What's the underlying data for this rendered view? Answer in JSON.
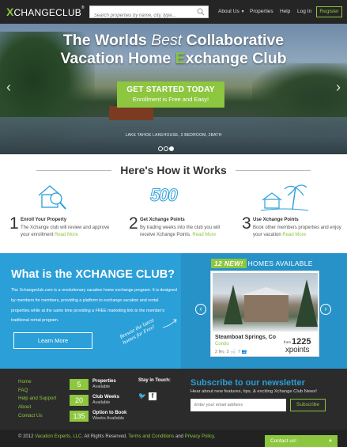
{
  "nav": {
    "logo_x": "X",
    "logo_rest": "CHANGECLUB",
    "search_placeholder": "Search properties by name, city, type...",
    "about": "About Us",
    "properties": "Properties",
    "help": "Help",
    "login": "Log In",
    "register": "Register"
  },
  "hero": {
    "title_part1": "The Worlds ",
    "title_best": "Best",
    "title_part2": " Collaborative",
    "title_line2a": "Vacation Home ",
    "title_line2_green": "E",
    "title_line2b": "xchange Club",
    "cta_line1": "GET STARTED TODAY",
    "cta_line2": "Enrollment is Free and Easy!",
    "caption": "LAKE TAHOE LAKEHOUSE, 3 BEDROOM, 2BATH"
  },
  "how": {
    "title": "Here's How it Works",
    "steps": [
      {
        "num": "1",
        "title": "Enroll Your Property",
        "desc": "The Xchange club will review and approve your enrollment ",
        "more": "Read More"
      },
      {
        "num": "2",
        "title": "Get Xchange Points",
        "desc": "By trading weeks into the club you will receive Xchange Points. ",
        "more": "Read More"
      },
      {
        "num": "3",
        "title": "Use Xchange Points",
        "desc": "Book other members properties and enjoy your vacation ",
        "more": "Read More"
      }
    ],
    "icon2_text": "500"
  },
  "what": {
    "title": "What is the XCHANGE CLUB?",
    "text": "The Xchangeclub.com is a revolutionary vacation home exchange program. It is designed by members for members, providing a platform to exchange vacation and rental properties while at the same time providing a FREE marketing link to the member's traditional rental program.",
    "learn_more": "Learn More",
    "browse": "Browse the latest homes for Free!"
  },
  "homes": {
    "count": "12",
    "new_label": "NEW!",
    "header": "HOMES AVAILABLE",
    "card": {
      "name": "Steamboat Springs, Co",
      "type": "Condo",
      "beds": "2",
      "baths": "2",
      "guests": "7",
      "from": "from",
      "points": "1225",
      "points_unit": "xpoints"
    }
  },
  "footer": {
    "links": [
      "Home",
      "FAQ",
      "Help and Support",
      "About",
      "Contact Us"
    ],
    "stats": [
      {
        "value": "5",
        "label": "Properties",
        "sub": "Available"
      },
      {
        "value": "20",
        "label": "Club Weeks",
        "sub": "Available"
      },
      {
        "value": "135",
        "label": "Option to Book",
        "sub": "Weeks Available"
      }
    ],
    "stay_in_touch": "Stay in Touch:",
    "newsletter_title": "Subscribe to our newsletter",
    "newsletter_sub": "Hear about new features, tips, & exciting Xchange Club News!",
    "email_placeholder": "Enter your email address",
    "subscribe": "Subscribe"
  },
  "copyright": {
    "prefix": "© 2012 ",
    "company": "Vacation Experts, LLC",
    "middle": ". All Rights Reserved. ",
    "terms": "Terms and Conditions",
    "and": " and ",
    "privacy": "Privacy Policy",
    "suffix": "."
  },
  "contact_tab": "Contact us!",
  "colors": {
    "green": "#8dc63f",
    "blue": "#2a9fd8",
    "dark": "#2b2b2b"
  }
}
